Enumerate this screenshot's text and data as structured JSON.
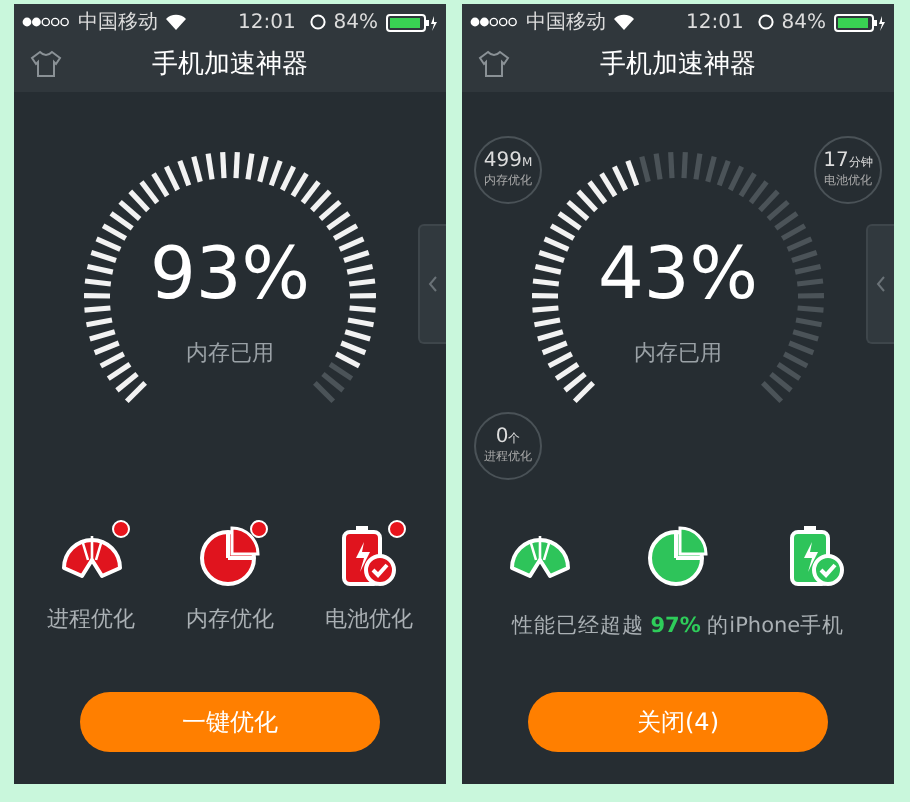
{
  "screens": [
    {
      "status_bar": {
        "carrier": "中国移动",
        "time": "12:01",
        "battery": "84%"
      },
      "title": "手机加速神器",
      "gauge": {
        "reading": "93%",
        "caption": "内存已用"
      },
      "features": [
        {
          "kind": "process",
          "optimized": false,
          "label": "进程优化"
        },
        {
          "kind": "memory",
          "optimized": false,
          "label": "内存优化"
        },
        {
          "kind": "battery",
          "optimized": false,
          "label": "电池优化"
        }
      ],
      "button": "一键优化"
    },
    {
      "status_bar": {
        "carrier": "中国移动",
        "time": "12:01",
        "battery": "84%"
      },
      "title": "手机加速神器",
      "gauge": {
        "reading": "43%",
        "caption": "内存已用"
      },
      "badges": [
        {
          "value": "499",
          "unit": "M",
          "label": "内存优化"
        },
        {
          "value": "17",
          "unit": "分钟",
          "label": "电池优化"
        },
        {
          "value": "0",
          "unit": "个",
          "label": "进程优化"
        }
      ],
      "features": [
        {
          "kind": "process",
          "optimized": true
        },
        {
          "kind": "memory",
          "optimized": true
        },
        {
          "kind": "battery",
          "optimized": true
        }
      ],
      "summary": {
        "before": "性能已经超越 ",
        "highlight": "97%",
        "after": " 的iPhone手机"
      },
      "button": "关闭(4)"
    }
  ]
}
